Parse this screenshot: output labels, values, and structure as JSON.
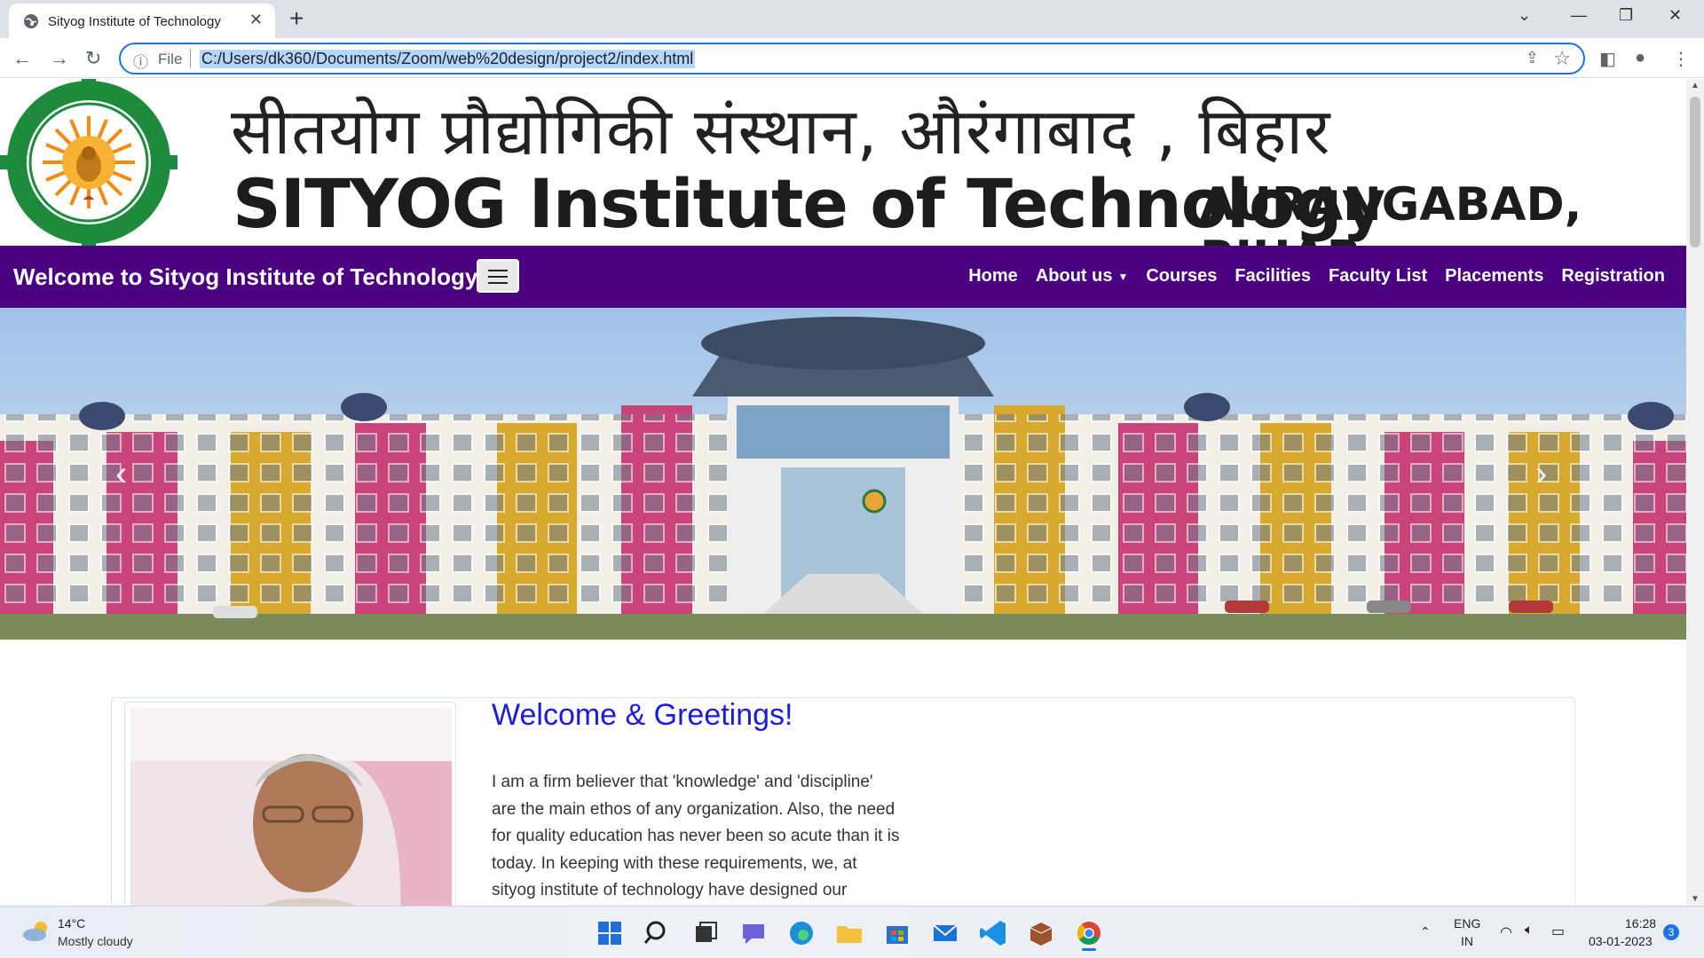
{
  "browser": {
    "tab_title": "Sityog Institute of Technology",
    "scheme_label": "File",
    "url": "C:/Users/dk360/Documents/Zoom/web%20design/project2/index.html"
  },
  "site": {
    "hindi_title": "सीतयोग प्रौद्योगिकी संस्थान, औरंगाबाद , बिहार",
    "english_title": "SITYOG Institute of Technology",
    "english_place": "AURANGABAD, BIHAR",
    "brand": "Welcome to Sityog Institute of Technology",
    "nav": [
      "Home",
      "About us",
      "Courses",
      "Facilities",
      "Faculty List",
      "Placements",
      "Registration"
    ]
  },
  "welcome": {
    "title": "Welcome & Greetings!",
    "lines": [
      "I am a firm believer that 'knowledge' and 'discipline'",
      "are the main ethos of any organization. Also, the need",
      "for quality education has never been so acute than it is",
      "today. In keeping with these requirements, we, at",
      "sityog institute of technology have designed our"
    ]
  },
  "taskbar": {
    "temp": "14°C",
    "weather": "Mostly cloudy",
    "lang1": "ENG",
    "lang2": "IN",
    "time": "16:28",
    "date": "03-01-2023",
    "notif_count": "3"
  },
  "colors": {
    "navbar": "#4b0082",
    "welcome_title": "#1a1ae6",
    "accent": "#1a73e8"
  }
}
